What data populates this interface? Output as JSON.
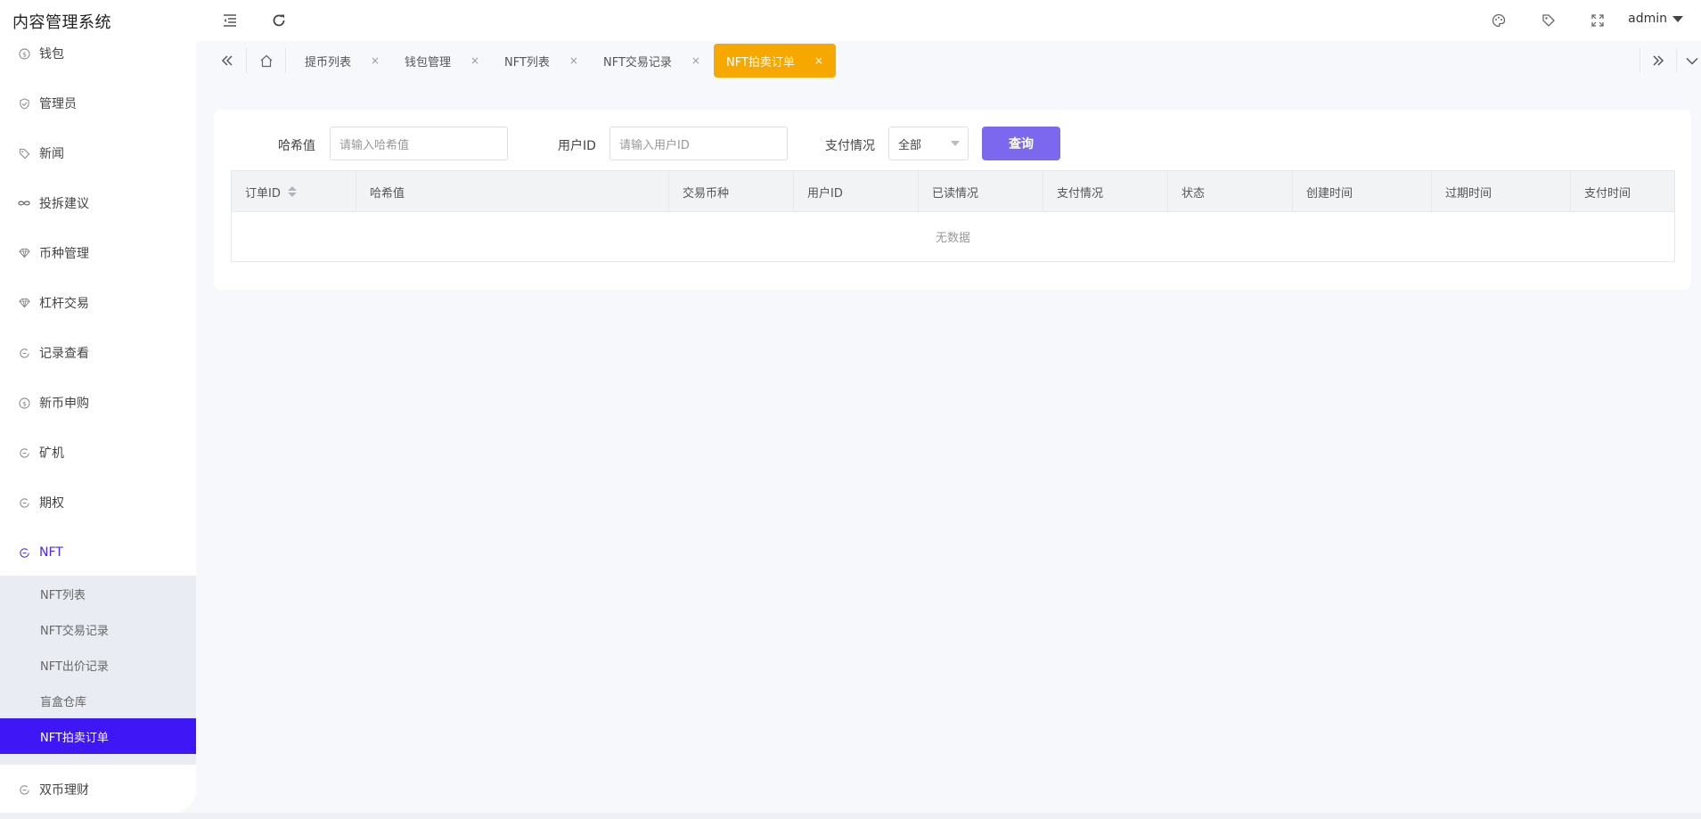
{
  "header": {
    "title": "内容管理系统",
    "icons": [
      "menu-fold-icon",
      "refresh-icon",
      "palette-icon",
      "tag-icon",
      "fullscreen-icon"
    ],
    "user": "admin"
  },
  "sidebar": {
    "items": [
      {
        "label": "钱包",
        "icon": "dollar-icon"
      },
      {
        "label": "管理员",
        "icon": "shield-icon"
      },
      {
        "label": "新闻",
        "icon": "tag-icon"
      },
      {
        "label": "投拆建议",
        "icon": "infinity-icon"
      },
      {
        "label": "币种管理",
        "icon": "diamond-icon"
      },
      {
        "label": "杠杆交易",
        "icon": "diamond-icon"
      },
      {
        "label": "记录查看",
        "icon": "cycle-icon"
      },
      {
        "label": "新币申购",
        "icon": "dollar-icon"
      },
      {
        "label": "矿机",
        "icon": "cycle-icon"
      },
      {
        "label": "期权",
        "icon": "cycle-icon"
      },
      {
        "label": "NFT",
        "icon": "cycle-icon"
      },
      {
        "label": "双币理财",
        "icon": "cycle-icon"
      }
    ],
    "nft_submenu": [
      "NFT列表",
      "NFT交易记录",
      "NFT出价记录",
      "盲盒仓库",
      "NFT拍卖订单"
    ]
  },
  "tabs": {
    "items": [
      {
        "label": "提币列表"
      },
      {
        "label": "钱包管理"
      },
      {
        "label": "NFT列表"
      },
      {
        "label": "NFT交易记录"
      },
      {
        "label": "NFT拍卖订单"
      }
    ],
    "close_glyph": "×"
  },
  "filters": {
    "hash_label": "哈希值",
    "hash_placeholder": "请输入哈希值",
    "user_label": "用户ID",
    "user_placeholder": "请输入用户ID",
    "pay_label": "支付情况",
    "pay_selected": "全部",
    "query_button": "查询"
  },
  "table": {
    "columns": [
      "订单ID",
      "哈希值",
      "交易币种",
      "用户ID",
      "已读情况",
      "支付情况",
      "状态",
      "创建时间",
      "过期时间",
      "支付时间"
    ],
    "empty_text": "无数据"
  },
  "colors": {
    "accent": "#7b68ee",
    "active_tab": "#f6a800",
    "active_submenu": "#3f16f5",
    "active_menu_text": "#4b2af2"
  }
}
